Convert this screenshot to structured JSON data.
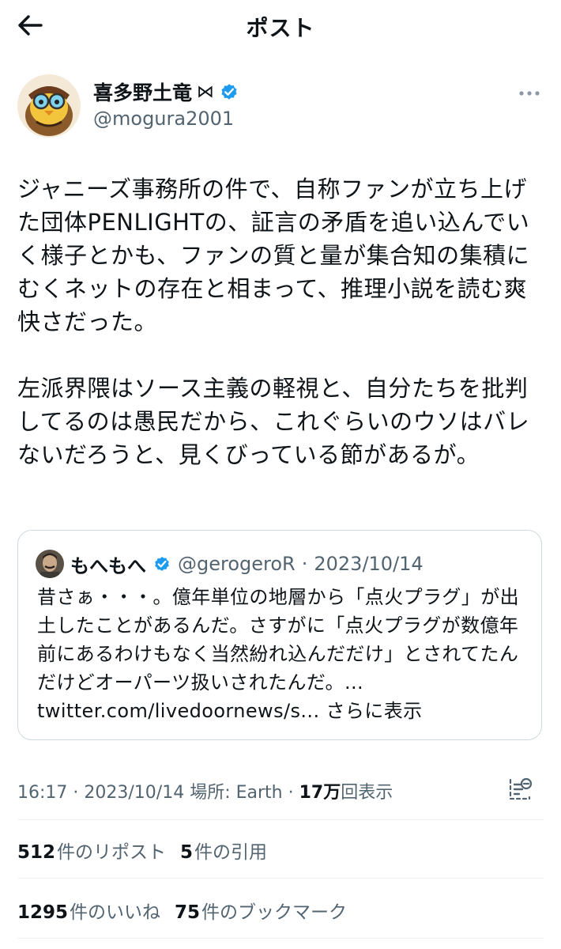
{
  "header": {
    "title": "ポスト"
  },
  "author": {
    "name": "喜多野土竜",
    "badge": "⋈",
    "handle": "@mogura2001"
  },
  "post": {
    "paragraphs": [
      "ジャニーズ事務所の件で、自称ファンが立ち上げた団体PENLIGHTの、証言の矛盾を追い込んでいく様子とかも、ファンの質と量が集合知の集積にむくネットの存在と相まって、推理小説を読む爽快さだった。",
      "左派界隈はソース主義の軽視と、自分たちを批判してるのは愚民だから、これぐらいのウソはバレないだろうと、見くびっている節があるが。"
    ]
  },
  "quote": {
    "name": "もへもへ",
    "handle": "@gerogeroR",
    "separator": "·",
    "date": "2023/10/14",
    "text": "昔さぁ・・・。億年単位の地層から「点火プラグ」が出土したことがあるんだ。さすがに「点火プラグが数億年前にあるわけもなく当然紛れ込んだだけ」とされてたんだけどオーパーツ扱いされたんだ。...",
    "link": "twitter.com/livedoornews/s...",
    "more": "さらに表示"
  },
  "meta": {
    "time": "16:17",
    "sep1": "·",
    "date": "2023/10/14",
    "location": "場所: Earth",
    "sep2": "·",
    "views_num": "17万",
    "views_label": "回表示"
  },
  "stats": {
    "reposts_num": "512",
    "reposts_label": "件のリポスト",
    "quotes_num": "5",
    "quotes_label": "件の引用",
    "likes_num": "1295",
    "likes_label": "件のいいね",
    "bookmarks_num": "75",
    "bookmarks_label": "件のブックマーク"
  },
  "colors": {
    "text": "#0f1419",
    "secondary": "#536471",
    "verified": "#1d9bf0",
    "border": "#cfd9de"
  }
}
